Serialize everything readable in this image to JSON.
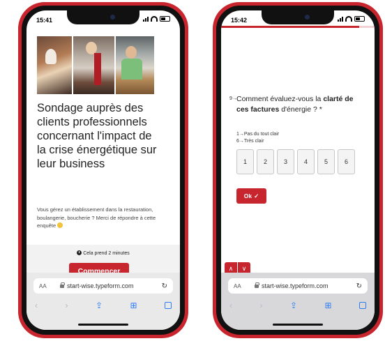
{
  "left": {
    "status_time": "15:41",
    "title": "Sondage auprès des clients professionnels concernant l'impact de la crise énergétique sur leur business",
    "description": "Vous gérez un établissement dans la restauration, boulangerie, boucherie ? Merci de répondre à cette enquête",
    "duration": "Cela prend 2 minutes",
    "start_label": "Commencer",
    "url": "start-wise.typeform.com",
    "aa": "AA"
  },
  "right": {
    "status_time": "15:42",
    "progress": 0.9,
    "question_number": "9→",
    "question_prefix": "Comment évaluez-vous la ",
    "question_bold": "clarté de ces factures",
    "question_suffix": " d'énergie ? *",
    "scale_min_label": "1→Pas du tout clair",
    "scale_max_label": "6→Très clair",
    "options": [
      "1",
      "2",
      "3",
      "4",
      "5",
      "6"
    ],
    "ok_label": "Ok",
    "url": "start-wise.typeform.com",
    "aa": "AA"
  },
  "colors": {
    "accent": "#c8262f",
    "safari_blue": "#2f7cf6"
  },
  "icons": [
    "clock-icon",
    "lock-icon",
    "reload-icon",
    "share-icon",
    "bookmarks-icon",
    "tabs-icon",
    "check-icon",
    "chevron-up-icon",
    "chevron-down-icon"
  ]
}
